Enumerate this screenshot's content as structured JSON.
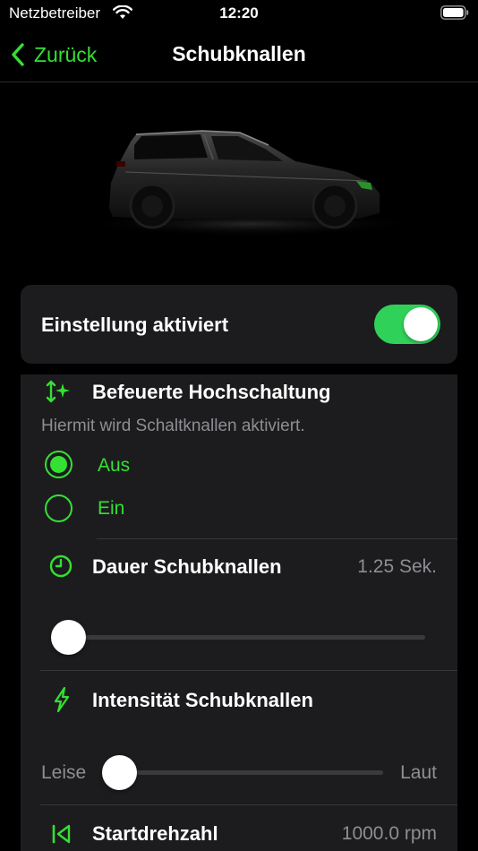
{
  "status_bar": {
    "carrier": "Netzbetreiber",
    "time": "12:20"
  },
  "nav": {
    "back_label": "Zurück",
    "title": "Schubknallen"
  },
  "colors": {
    "accent": "#33e033",
    "switch_on": "#30d158",
    "card_bg": "#1c1c1e"
  },
  "toggle": {
    "label": "Einstellung aktiviert",
    "on": true
  },
  "upshift": {
    "icon": "sparkle-arrows-icon",
    "title": "Befeuerte Hochschaltung",
    "description": "Hiermit wird Schaltknallen aktiviert.",
    "options": [
      {
        "label": "Aus",
        "selected": true
      },
      {
        "label": "Ein",
        "selected": false
      }
    ]
  },
  "duration": {
    "icon": "clock-icon",
    "title": "Dauer Schubknallen",
    "value": "1.25 Sek.",
    "slider_fraction": 0.0
  },
  "intensity": {
    "icon": "lightning-icon",
    "title": "Intensität Schubknallen",
    "min_label": "Leise",
    "max_label": "Laut",
    "slider_fraction": 0.0
  },
  "start_rpm": {
    "icon": "skip-back-icon",
    "title": "Startdrehzahl",
    "value": "1000.0 rpm"
  }
}
